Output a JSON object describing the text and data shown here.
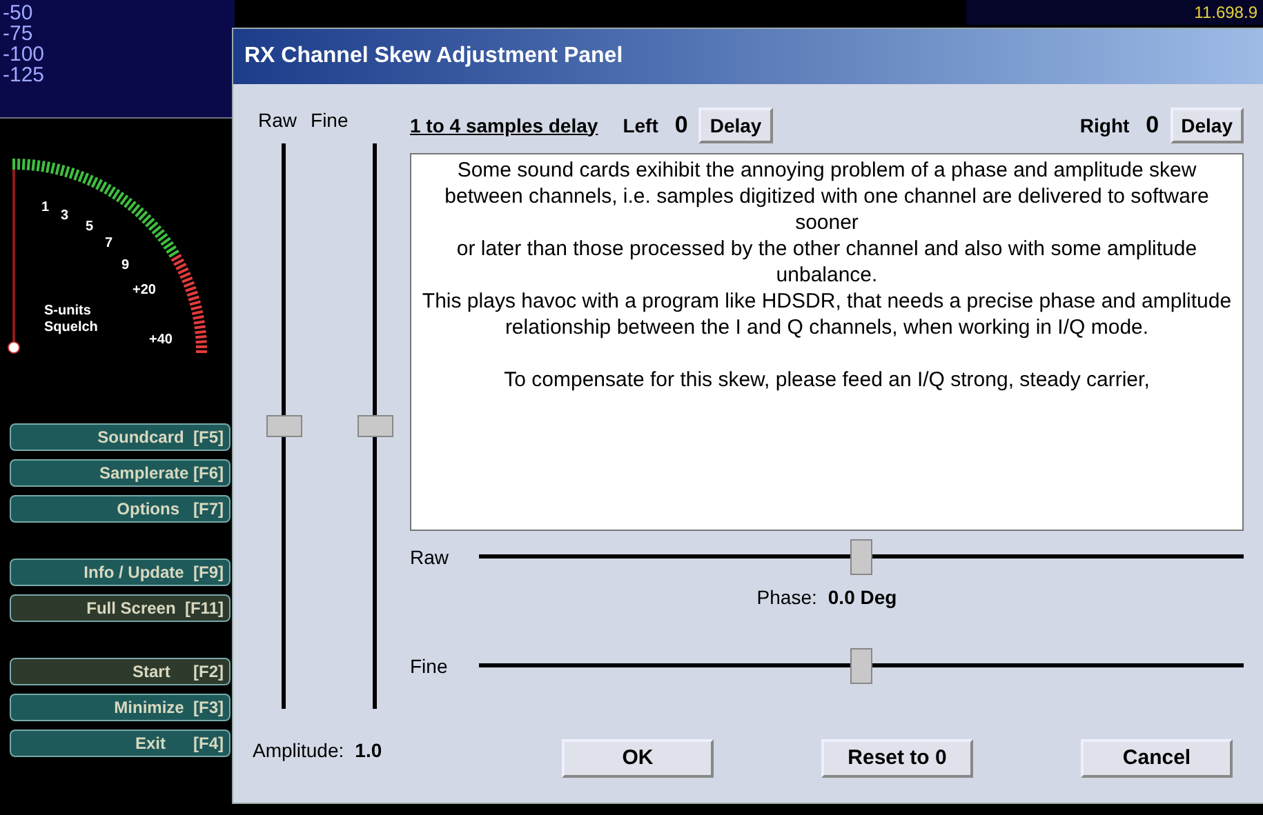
{
  "background": {
    "scale_labels": [
      "-50",
      "-75",
      "-100",
      "-125"
    ],
    "frequency": "11.698.9",
    "meter": {
      "labels": [
        "1",
        "3",
        "5",
        "7",
        "9",
        "+20",
        "+40"
      ],
      "caption": [
        "S-units",
        "Squelch"
      ]
    },
    "buttons": [
      {
        "label": "Soundcard  [F5]",
        "kind": "teal"
      },
      {
        "label": "Samplerate [F6]",
        "kind": "teal"
      },
      {
        "label": "Options   [F7]",
        "kind": "teal"
      },
      {
        "label": "Info / Update  [F9]",
        "kind": "teal"
      },
      {
        "label": "Full Screen  [F11]",
        "kind": "dark"
      },
      {
        "label": "Start     [F2]",
        "kind": "dark"
      },
      {
        "label": "Minimize  [F3]",
        "kind": "teal"
      },
      {
        "label": "Exit      [F4]",
        "kind": "teal"
      }
    ]
  },
  "dialog": {
    "title": "RX Channel Skew Adjustment Panel",
    "vertical_sliders": [
      {
        "label": "Raw",
        "level": 0.5
      },
      {
        "label": "Fine",
        "level": 0.5
      }
    ],
    "delay_link": "1 to 4 samples delay",
    "left": {
      "label": "Left",
      "value": "0",
      "button": "Delay"
    },
    "right": {
      "label": "Right",
      "value": "0",
      "button": "Delay"
    },
    "info_lines": [
      "Some sound cards exihibit the annoying problem of a phase and amplitude skew",
      "between channels, i.e. samples digitized with one channel are delivered to software sooner",
      "or later than those processed by the other channel and also with some amplitude unbalance.",
      "This plays havoc with a program like HDSDR, that needs a precise phase and amplitude",
      "relationship between the I and Q channels, when working in I/Q mode.",
      "To compensate for this skew, please feed an I/Q strong, steady carrier,"
    ],
    "raw_slider": {
      "label": "Raw",
      "level": 0.5
    },
    "phase": {
      "label": "Phase:",
      "value": "0.0 Deg"
    },
    "fine_slider": {
      "label": "Fine",
      "level": 0.5
    },
    "amplitude": {
      "label": "Amplitude:",
      "value": "1.0"
    },
    "buttons": [
      "OK",
      "Reset to 0",
      "Cancel"
    ]
  }
}
